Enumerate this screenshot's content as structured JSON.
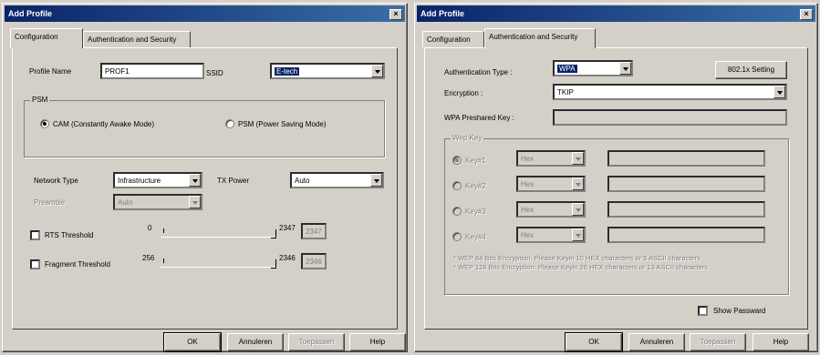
{
  "left": {
    "title": "Add Profile",
    "tabs": [
      "Configuration",
      "Authentication and Security"
    ],
    "profile_name_label": "Profile Name",
    "profile_name_value": "PROF1",
    "ssid_label": "SSID",
    "ssid_value": "E-tech",
    "psm_legend": "PSM",
    "cam_label": "CAM (Constantly Awake Mode)",
    "psm_label": "PSM (Power Saving Mode)",
    "network_type_label": "Network Type",
    "network_type_value": "Infrastructure",
    "tx_power_label": "TX Power",
    "tx_power_value": "Auto",
    "preamble_label": "Preamble",
    "preamble_value": "Auto",
    "rts_label": "RTS Threshold",
    "rts_min": "0",
    "rts_max": "2347",
    "rts_value": "2347",
    "frag_label": "Fragment Threshold",
    "frag_min": "256",
    "frag_max": "2346",
    "frag_value": "2346"
  },
  "right": {
    "title": "Add Profile",
    "tabs": [
      "Configuration",
      "Authentication and Security"
    ],
    "auth_type_label": "Authentication Type :",
    "auth_type_value": "WPA",
    "setting_button": "802.1x Setting",
    "encryption_label": "Encryption :",
    "encryption_value": "TKIP",
    "wpa_key_label": "WPA Preshared Key :",
    "wpa_key_value": "",
    "wep_legend": "Wep Key",
    "keys": [
      {
        "label": "Key#1",
        "format": "Hex"
      },
      {
        "label": "Key#2",
        "format": "Hex"
      },
      {
        "label": "Key#3",
        "format": "Hex"
      },
      {
        "label": "Key#4",
        "format": "Hex"
      }
    ],
    "note1": "* WEP 64 Bits Encryption:  Please Keyin 10 HEX characters or 5 ASCII characters",
    "note2": "* WEP 128 Bits Encryption:  Please Keyin 26 HEX characters or 13 ASCII characters",
    "show_password_label": "Show Passward"
  },
  "buttons": {
    "ok": "OK",
    "cancel": "Annuleren",
    "apply": "Toepassen",
    "help": "Help"
  },
  "colors": {
    "titlebar": "#0a246a",
    "face": "#d4d0c8",
    "selection": "#0a246a"
  }
}
